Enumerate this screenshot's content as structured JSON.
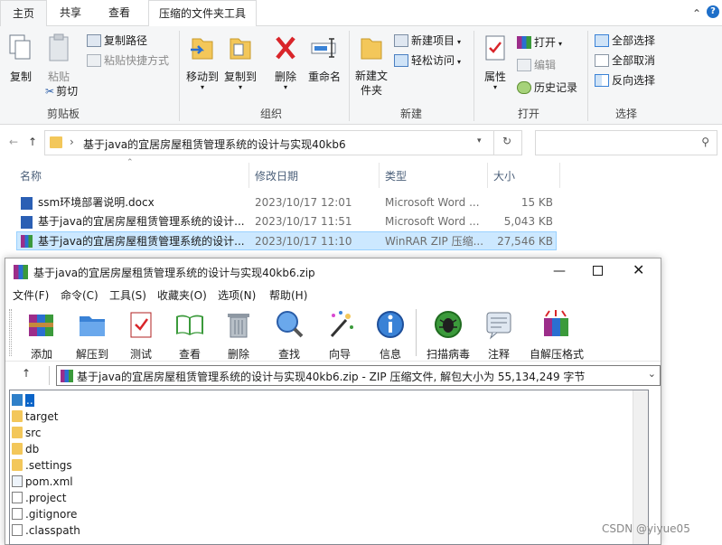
{
  "explorer": {
    "tabs": [
      "主页",
      "共享",
      "查看",
      "压缩的文件夹工具"
    ],
    "ribbon": {
      "clipboard": {
        "copy": "复制",
        "paste": "粘贴",
        "copy_path": "复制路径",
        "paste_shortcut": "粘贴快捷方式",
        "cut": "剪切",
        "label": "剪贴板"
      },
      "organize": {
        "move_to": "移动到",
        "copy_to": "复制到",
        "delete": "删除",
        "rename": "重命名",
        "label": "组织"
      },
      "new": {
        "new_folder": "新建文件夹",
        "new_item": "新建项目",
        "easy_access": "轻松访问",
        "label": "新建"
      },
      "open": {
        "properties": "属性",
        "open": "打开",
        "edit": "编辑",
        "history": "历史记录",
        "label": "打开"
      },
      "select": {
        "select_all": "全部选择",
        "select_none": "全部取消",
        "invert": "反向选择",
        "label": "选择"
      }
    },
    "address": {
      "path": "基于java的宜居房屋租赁管理系统的设计与实现40kb6",
      "search_placeholder": ""
    },
    "columns": {
      "name": "名称",
      "date": "修改日期",
      "type": "类型",
      "size": "大小"
    },
    "files": [
      {
        "name": "ssm环境部署说明.docx",
        "date": "2023/10/17 12:01",
        "type": "Microsoft Word ...",
        "size": "15 KB"
      },
      {
        "name": "基于java的宜居房屋租赁管理系统的设计...",
        "date": "2023/10/17 11:51",
        "type": "Microsoft Word ...",
        "size": "5,043 KB"
      },
      {
        "name": "基于java的宜居房屋租赁管理系统的设计...",
        "date": "2023/10/17 11:10",
        "type": "WinRAR ZIP 压缩...",
        "size": "27,546 KB"
      }
    ]
  },
  "rar": {
    "title": "基于java的宜居房屋租赁管理系统的设计与实现40kb6.zip",
    "menu": [
      "文件(F)",
      "命令(C)",
      "工具(S)",
      "收藏夹(O)",
      "选项(N)",
      "帮助(H)"
    ],
    "toolbar": [
      "添加",
      "解压到",
      "测试",
      "查看",
      "删除",
      "查找",
      "向导",
      "信息",
      "扫描病毒",
      "注释",
      "自解压格式"
    ],
    "path": "基于java的宜居房屋租赁管理系统的设计与实现40kb6.zip - ZIP 压缩文件, 解包大小为 55,134,249 字节",
    "items": [
      {
        "name": "..",
        "kind": "up"
      },
      {
        "name": "target",
        "kind": "folder"
      },
      {
        "name": "src",
        "kind": "folder"
      },
      {
        "name": "db",
        "kind": "folder"
      },
      {
        "name": ".settings",
        "kind": "folder"
      },
      {
        "name": "pom.xml",
        "kind": "xml"
      },
      {
        "name": ".project",
        "kind": "file"
      },
      {
        "name": ".gitignore",
        "kind": "file"
      },
      {
        "name": ".classpath",
        "kind": "file"
      }
    ]
  },
  "watermark": "CSDN @yiyue05"
}
